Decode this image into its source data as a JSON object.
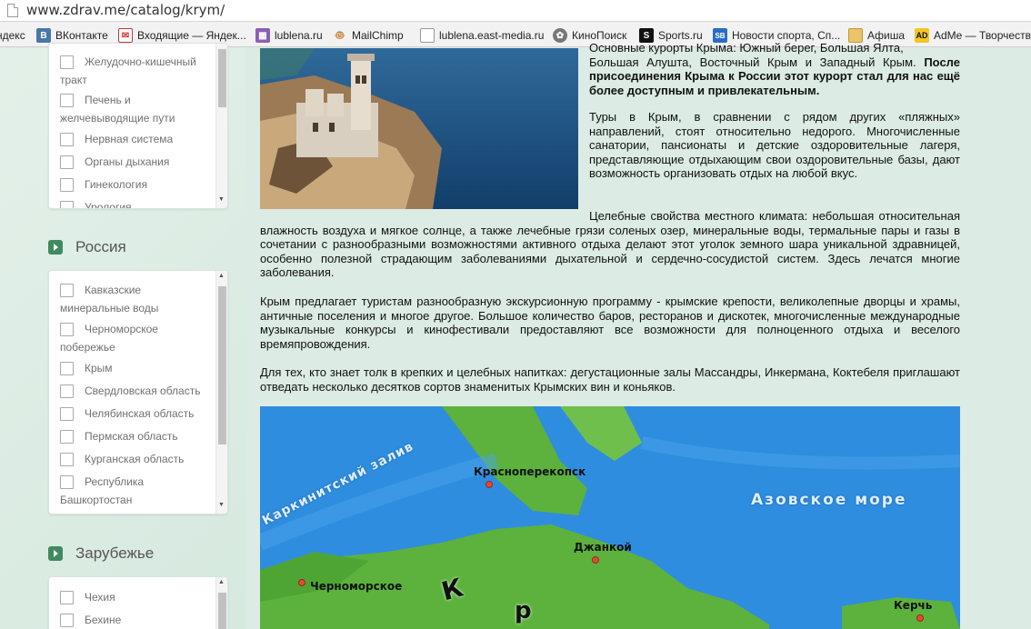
{
  "browser": {
    "url": "www.zdrav.me/catalog/krym/",
    "bookmarks": [
      {
        "label": "ндекс",
        "icon": "yandex-icon"
      },
      {
        "label": "ВКонтакте",
        "icon": "vk-icon"
      },
      {
        "label": "Входящие — Яндек...",
        "icon": "mail-icon"
      },
      {
        "label": "lublena.ru",
        "icon": "lublena-icon"
      },
      {
        "label": "MailChimp",
        "icon": "mailchimp-icon"
      },
      {
        "label": "lublena.east-media.ru",
        "icon": "page-icon"
      },
      {
        "label": "КиноПоиск",
        "icon": "kinopoisk-icon"
      },
      {
        "label": "Sports.ru",
        "icon": "sports-icon"
      },
      {
        "label": "Новости спорта, Сп...",
        "icon": "sb-icon"
      },
      {
        "label": "Афиша",
        "icon": "folder-icon"
      },
      {
        "label": "AdMe — Творчеств",
        "icon": "adme-icon"
      }
    ]
  },
  "sidebar": {
    "diseases": [
      {
        "label": "Желудочно-кишечный тракт"
      },
      {
        "label": "Печень и желчевыводящие пути"
      },
      {
        "label": "Нервная система"
      },
      {
        "label": "Органы дыхания"
      },
      {
        "label": "Гинекология"
      },
      {
        "label": "Урология"
      }
    ],
    "russia": {
      "title": "Россия",
      "items": [
        {
          "label": "Кавказские минеральные воды"
        },
        {
          "label": "Черноморское побережье"
        },
        {
          "label": "Крым"
        },
        {
          "label": "Свердловская область"
        },
        {
          "label": "Челябинская область"
        },
        {
          "label": "Пермская область"
        },
        {
          "label": "Курганская область"
        },
        {
          "label": "Республика Башкортостан"
        }
      ]
    },
    "abroad": {
      "title": "Зарубежье",
      "items": [
        {
          "label": "Чехия"
        },
        {
          "label": "Бехине"
        }
      ]
    }
  },
  "article": {
    "p1_top": "Основные курорты Крыма: Южный берег, Большая Ялта,",
    "p1_line2": "Большая Алушта, Восточный Крым и Западный Крым.",
    "p1_bold": "После присоединения Крыма к России этот курорт стал для нас ещё более доступным и привлекательным.",
    "p2": "Туры в Крым, в сравнении с рядом других «пляжных» направлений, стоят относительно недорого. Многочисленные санатории, пансионаты и детские оздоровительные лагеря, представляющие отдыхающим свои оздоровительные базы, дают возможность организовать отдых на любой вкус.",
    "p3": "Целебные свойства местного климата: небольшая относительная влажность воздуха и мягкое солнце, а также лечебные грязи соленых озер, минеральные воды, термальные пары и газы в сочетании с разнообразными возможностями активного отдыха делают этот уголок земного шара уникальной здравницей, особенно полезной страдающим заболеваниями дыхательной и сердечно-сосудистой систем. Здесь лечатся многие заболевания.",
    "p4": "Крым предлагает туристам разнообразную экскурсионную программу - крымские крепости, великолепные дворцы и храмы, античные поселения и многое другое. Большое количество баров, ресторанов и дискотек, многочисленные международные музыкальные конкурсы и кинофестивали предоставляют все возможности для полноценного отдыха и веселого времяпровождения.",
    "p5": "Для тех, кто знает толк в крепких и целебных напитках: дегустационные залы Массандры, Инкермана, Коктебеля приглашают отведать несколько десятков сортов знаменитых Крымских вин и коньяков."
  },
  "map": {
    "sea_azov": "Азовское море",
    "gulf": "Каркинитский залив",
    "cities": [
      "Красноперекопск",
      "Джанкой",
      "Черноморское",
      "Керчь"
    ],
    "big_letters": [
      "К",
      "р"
    ]
  },
  "colors": {
    "background": "#dcebe3",
    "accent": "#3f8a5e",
    "sea": "#2f8de0",
    "land": "#5cb23c"
  }
}
